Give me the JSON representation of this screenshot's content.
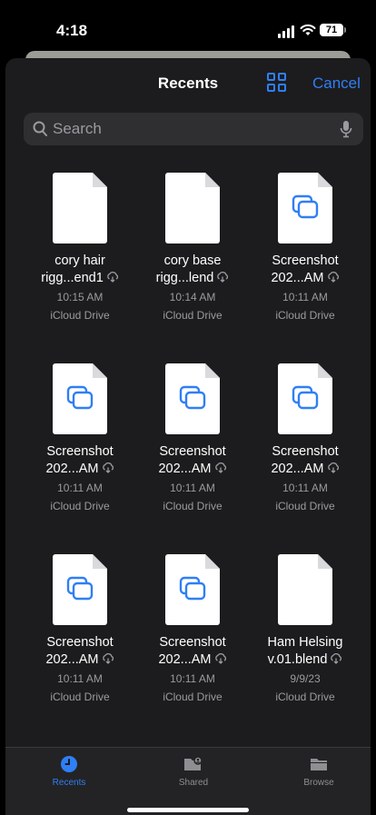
{
  "status_bar": {
    "time": "4:18",
    "battery": "71"
  },
  "header": {
    "title": "Recents",
    "cancel_label": "Cancel",
    "view_toggle_icon": "grid-view-icon"
  },
  "search": {
    "placeholder": "Search",
    "value": ""
  },
  "colors": {
    "accent": "#2f7ff5",
    "background": "#1c1c1e",
    "secondary_text": "#9a9aa0"
  },
  "files": [
    {
      "line1": "cory hair",
      "line2": "rigg...end1",
      "time": "10:15 AM",
      "location": "iCloud Drive",
      "icon": "document-icon"
    },
    {
      "line1": "cory base",
      "line2": "rigg...lend",
      "time": "10:14 AM",
      "location": "iCloud Drive",
      "icon": "document-icon"
    },
    {
      "line1": "Screenshot",
      "line2": "202...AM",
      "time": "10:11 AM",
      "location": "iCloud Drive",
      "icon": "screenshot-icon"
    },
    {
      "line1": "Screenshot",
      "line2": "202...AM",
      "time": "10:11 AM",
      "location": "iCloud Drive",
      "icon": "screenshot-icon"
    },
    {
      "line1": "Screenshot",
      "line2": "202...AM",
      "time": "10:11 AM",
      "location": "iCloud Drive",
      "icon": "screenshot-icon"
    },
    {
      "line1": "Screenshot",
      "line2": "202...AM",
      "time": "10:11 AM",
      "location": "iCloud Drive",
      "icon": "screenshot-icon"
    },
    {
      "line1": "Screenshot",
      "line2": "202...AM",
      "time": "10:11 AM",
      "location": "iCloud Drive",
      "icon": "screenshot-icon"
    },
    {
      "line1": "Screenshot",
      "line2": "202...AM",
      "time": "10:11 AM",
      "location": "iCloud Drive",
      "icon": "screenshot-icon"
    },
    {
      "line1": "Ham Helsing",
      "line2": "v.01.blend",
      "time": "9/9/23",
      "location": "iCloud Drive",
      "icon": "document-icon"
    }
  ],
  "tab_bar": {
    "tabs": [
      {
        "label": "Recents",
        "icon": "clock-icon",
        "active": true
      },
      {
        "label": "Shared",
        "icon": "shared-folder-icon",
        "active": false
      },
      {
        "label": "Browse",
        "icon": "folder-icon",
        "active": false
      }
    ]
  }
}
